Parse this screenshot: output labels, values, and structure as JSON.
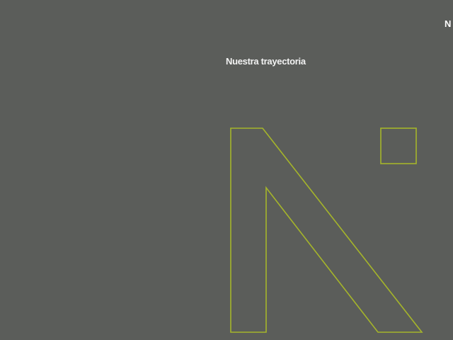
{
  "header": {
    "corner_logo_text": "N"
  },
  "section": {
    "title": "Nuestra trayectoria"
  },
  "colors": {
    "background": "#5b5d5a",
    "accent_outline": "#a5b52a",
    "title_text": "#f2f2f2"
  },
  "icons": {
    "brand_mark": "n-logo-outline-icon"
  }
}
